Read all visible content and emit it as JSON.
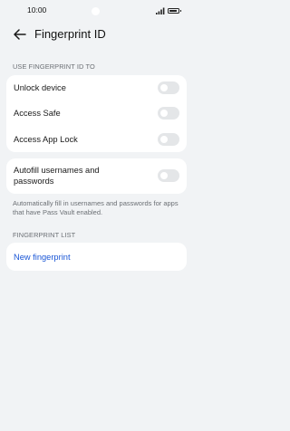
{
  "status_bar": {
    "time": "10:00",
    "battery_level": 0.9
  },
  "header": {
    "title": "Fingerprint ID",
    "back_icon": "arrow-left-icon"
  },
  "sections": {
    "use_fingerprint_label": "USE FINGERPRINT ID TO",
    "fingerprint_list_label": "FINGERPRINT LIST"
  },
  "toggles": [
    {
      "label": "Unlock device",
      "on": false
    },
    {
      "label": "Access Safe",
      "on": false
    },
    {
      "label": "Access App Lock",
      "on": false
    }
  ],
  "autofill": {
    "label": "Autofill usernames and passwords",
    "on": false,
    "helper": "Automatically fill in usernames and passwords for apps that have Pass Vault enabled."
  },
  "fingerprint_list": {
    "new_label": "New fingerprint"
  },
  "colors": {
    "background": "#f1f3f5",
    "card": "#ffffff",
    "link": "#1a56d6",
    "toggle_off": "#e4e6e8",
    "secondary_text": "#6b6f74"
  }
}
